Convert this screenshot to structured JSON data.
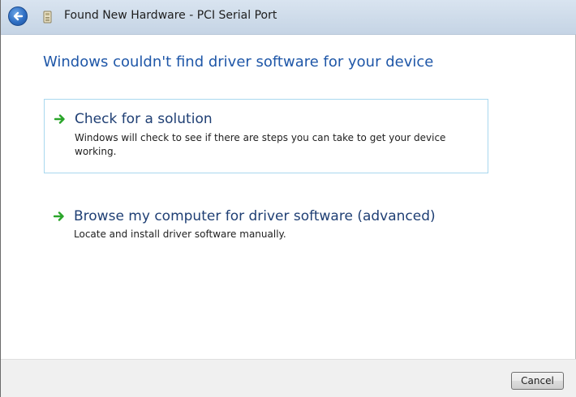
{
  "window": {
    "title": "Found New Hardware - PCI Serial Port"
  },
  "main": {
    "heading": "Windows couldn't find driver software for your device",
    "options": [
      {
        "title": "Check for a solution",
        "description": "Windows will check to see if there are steps you can take to get your device working."
      },
      {
        "title": "Browse my computer for driver software (advanced)",
        "description": "Locate and install driver software manually."
      }
    ]
  },
  "footer": {
    "cancel_label": "Cancel"
  },
  "icons": {
    "back": "back-arrow-icon",
    "title": "hardware-device-icon",
    "option_arrow": "green-arrow-icon"
  },
  "colors": {
    "heading": "#1f57a8",
    "option_title": "#1f3f74",
    "arrow": "#2aa52a",
    "hover_border": "#a9d8ef"
  }
}
